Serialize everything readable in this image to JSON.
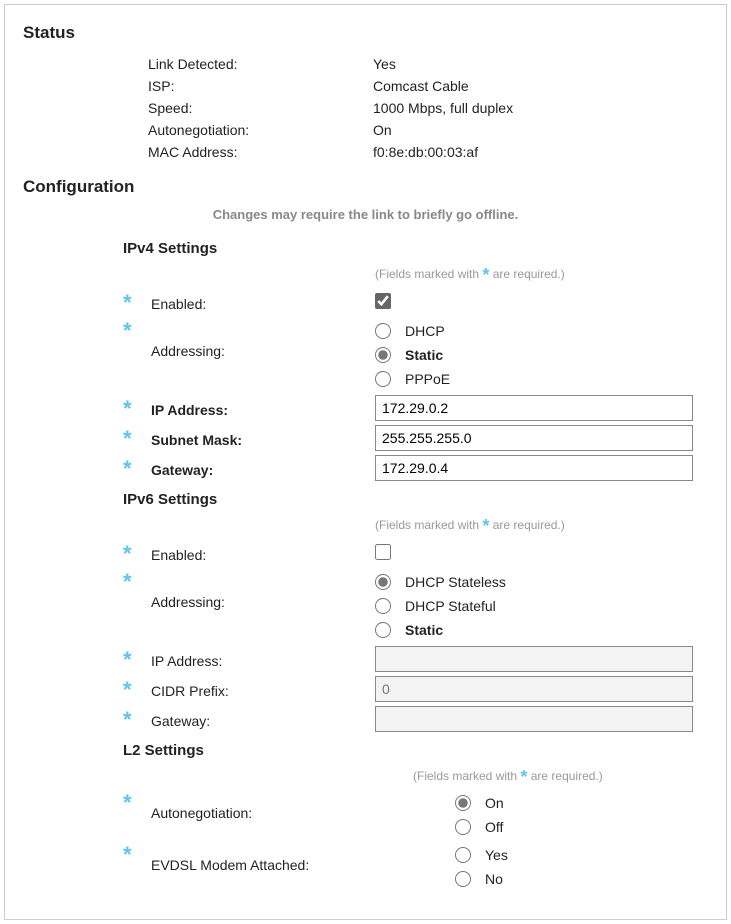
{
  "sections": {
    "status_title": "Status",
    "config_title": "Configuration",
    "note": "Changes may require the link to briefly go offline."
  },
  "status": {
    "link_detected_label": "Link Detected:",
    "link_detected_value": "Yes",
    "isp_label": "ISP:",
    "isp_value": "Comcast Cable",
    "speed_label": "Speed:",
    "speed_value": "1000 Mbps, full duplex",
    "autoneg_label": "Autonegotiation:",
    "autoneg_value": "On",
    "mac_label": "MAC Address:",
    "mac_value": "f0:8e:db:00:03:af"
  },
  "req_note_prefix": "(Fields marked with ",
  "req_note_suffix": " are required.)",
  "ipv4": {
    "header": "IPv4 Settings",
    "enabled_label": "Enabled:",
    "addressing_label": "Addressing:",
    "opt_dhcp": "DHCP",
    "opt_static": "Static",
    "opt_pppoe": "PPPoE",
    "ip_label": "IP Address:",
    "ip_value": "172.29.0.2",
    "subnet_label": "Subnet Mask:",
    "subnet_value": "255.255.255.0",
    "gateway_label": "Gateway:",
    "gateway_value": "172.29.0.4"
  },
  "ipv6": {
    "header": "IPv6 Settings",
    "enabled_label": "Enabled:",
    "addressing_label": "Addressing:",
    "opt_stateless": "DHCP Stateless",
    "opt_stateful": "DHCP Stateful",
    "opt_static": "Static",
    "ip_label": "IP Address:",
    "ip_value": "",
    "cidr_label": "CIDR Prefix:",
    "cidr_value": "0",
    "gateway_label": "Gateway:",
    "gateway_value": ""
  },
  "l2": {
    "header": "L2 Settings",
    "autoneg_label": "Autonegotiation:",
    "opt_on": "On",
    "opt_off": "Off",
    "evdsl_label": "EVDSL Modem Attached:",
    "opt_yes": "Yes",
    "opt_no": "No"
  }
}
